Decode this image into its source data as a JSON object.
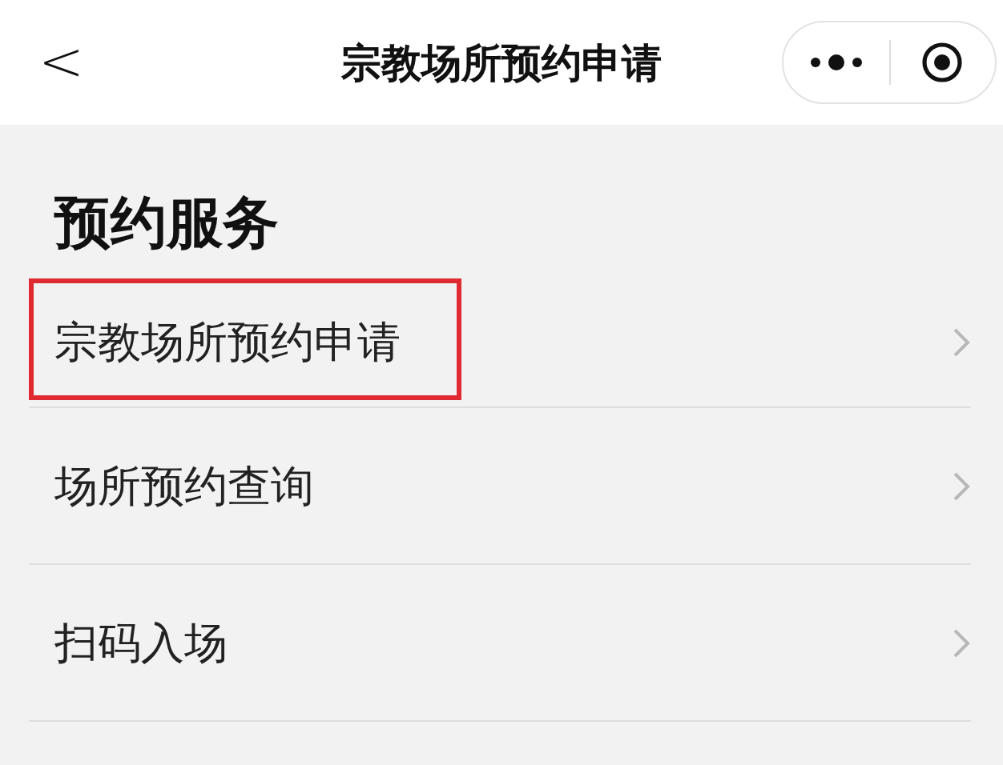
{
  "nav_bar": {
    "back": "<",
    "title": "宗教场所预约申请"
  },
  "section": {
    "title": "预约服务"
  },
  "items": [
    {
      "label": "宗教场所预约申请",
      "highlighted": true
    },
    {
      "label": "场所预约查询",
      "highlighted": false
    },
    {
      "label": "扫码入场",
      "highlighted": false
    }
  ]
}
